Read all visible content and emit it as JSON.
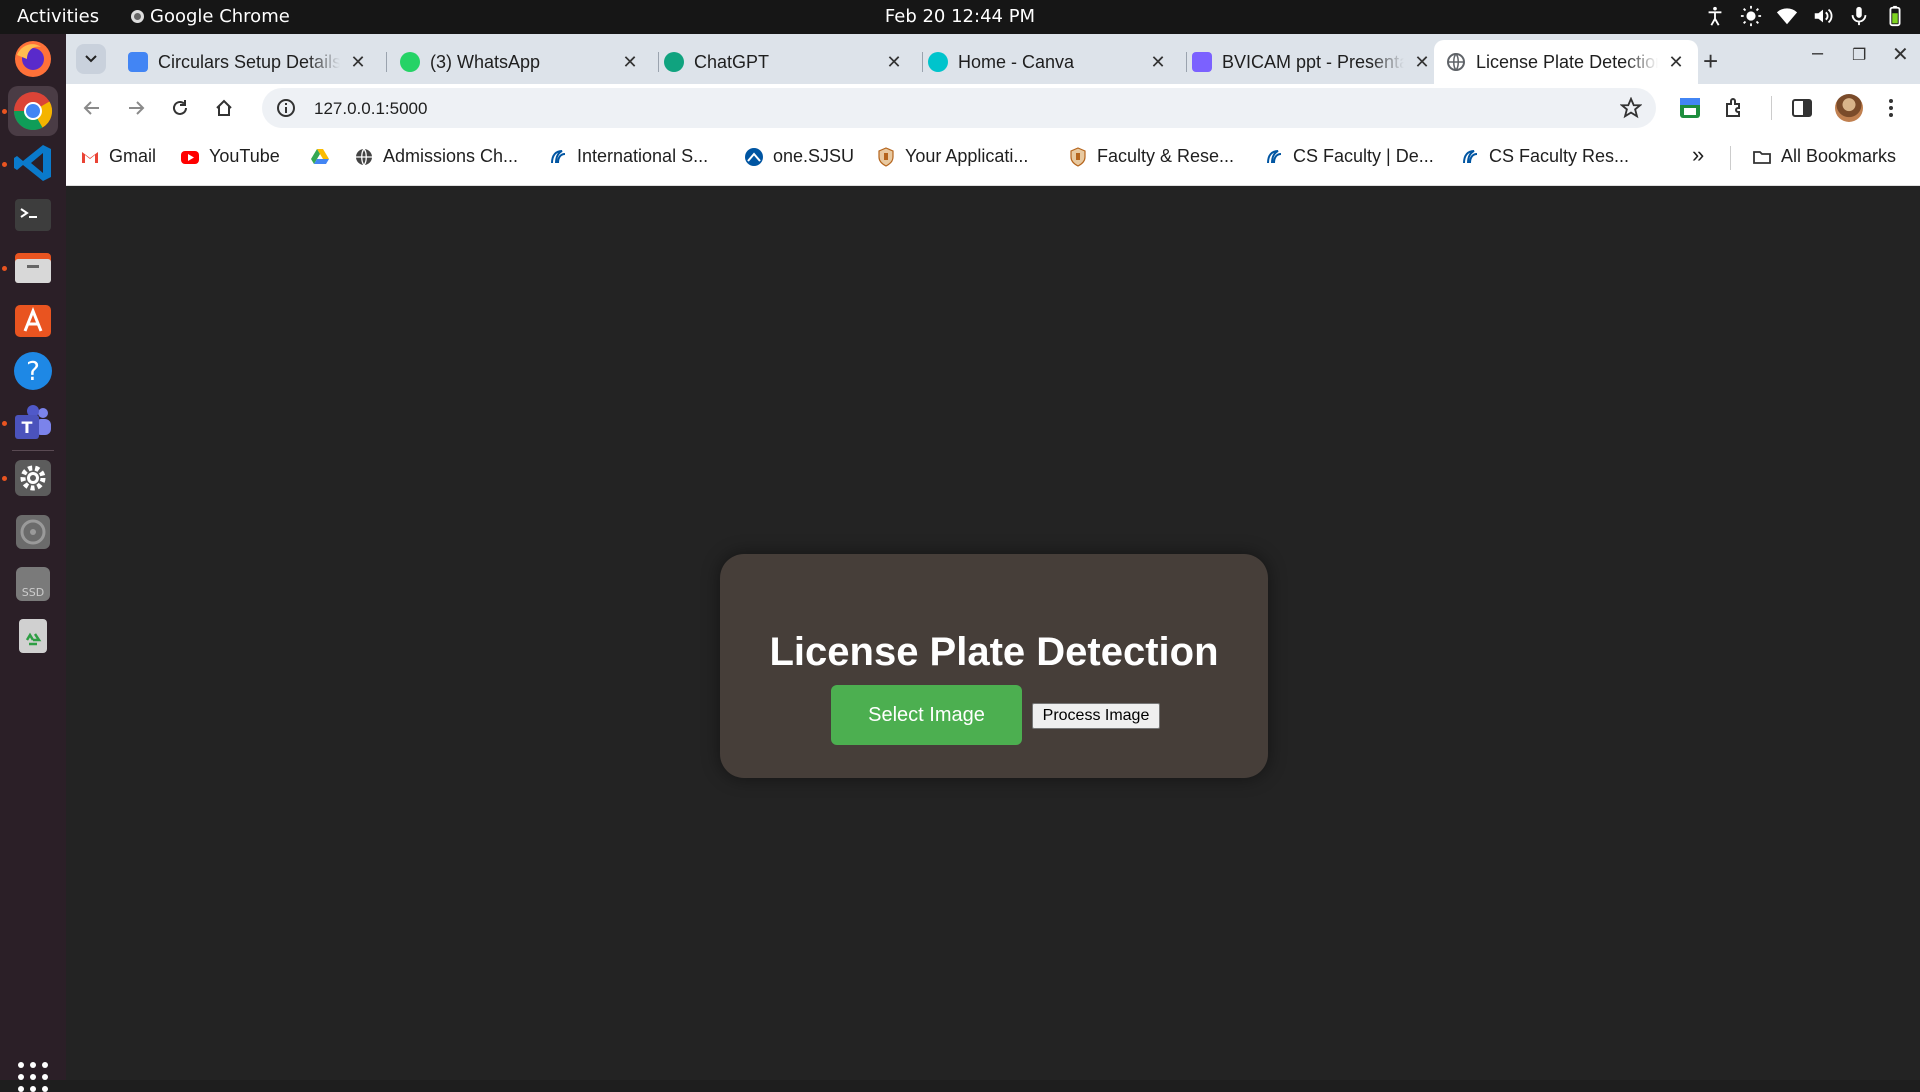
{
  "topbar": {
    "activities": "Activities",
    "app_name": "Google Chrome",
    "clock": "Feb 20  12:44 PM"
  },
  "dock": {
    "items": [
      "firefox-icon",
      "chrome-icon",
      "vscode-icon",
      "terminal-icon",
      "files-icon",
      "app-center-icon",
      "help-icon",
      "teams-icon",
      "settings-icon",
      "disc-icon",
      "ssd-icon",
      "trash-icon"
    ]
  },
  "tabs": [
    {
      "title": "Circulars Setup Details",
      "favicon_color": "#4285f4"
    },
    {
      "title": "(3) WhatsApp",
      "favicon_color": "#25d366",
      "badge": "3"
    },
    {
      "title": "ChatGPT",
      "favicon_color": "#10a37f"
    },
    {
      "title": "Home - Canva",
      "favicon_color": "#00c4cc"
    },
    {
      "title": "BVICAM ppt - Presentation",
      "favicon_color": "#7b61ff"
    },
    {
      "title": "License Plate Detection",
      "favicon_color": "#5f6368",
      "active": true
    }
  ],
  "toolbar": {
    "url": "127.0.0.1:5000"
  },
  "bookmarks": {
    "items": [
      {
        "label": "Gmail",
        "icon": "gmail-icon"
      },
      {
        "label": "YouTube",
        "icon": "youtube-icon"
      },
      {
        "label": "",
        "icon": "drive-icon"
      },
      {
        "label": "Admissions Ch...",
        "icon": "globe-icon"
      },
      {
        "label": "International S...",
        "icon": "sjsu-icon"
      },
      {
        "label": "one.SJSU",
        "icon": "onesjsu-icon"
      },
      {
        "label": "Your Applicati...",
        "icon": "shield-icon"
      },
      {
        "label": "Faculty & Rese...",
        "icon": "shield-icon"
      },
      {
        "label": "CS Faculty | De...",
        "icon": "sjsu-icon"
      },
      {
        "label": "CS Faculty Res...",
        "icon": "sjsu-icon"
      }
    ],
    "overflow": "»",
    "all_bookmarks": "All Bookmarks"
  },
  "page": {
    "heading": "License Plate Detection",
    "select_button": "Select Image",
    "process_button": "Process Image"
  },
  "colors": {
    "accent_green": "#4caf50",
    "card_bg": "#463e39",
    "page_bg": "#232323"
  }
}
